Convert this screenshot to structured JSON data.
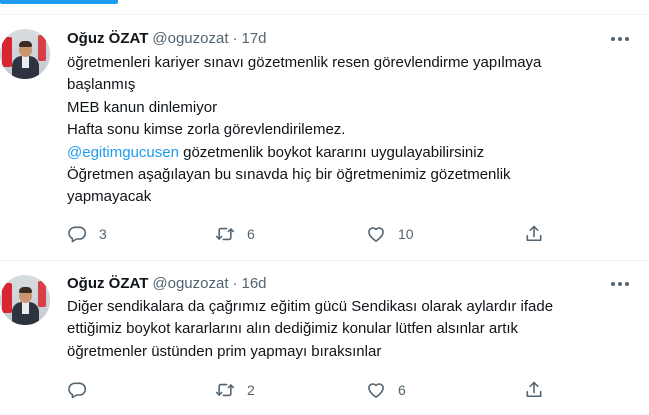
{
  "tweets": [
    {
      "display_name": "Oğuz ÖZAT",
      "handle": "@oguzozat",
      "separator": "·",
      "time": "17d",
      "lines": [
        "öğretmenleri kariyer sınavı gözetmenlik resen görevlendirme yapılmaya",
        "başlanmış",
        "MEB kanun dinlemiyor",
        "Hafta sonu kimse zorla görevlendirilemez."
      ],
      "mention": "@egitimgucusen",
      "mention_rest": " gözetmenlik boykot kararını uygulayabilirsiniz",
      "lines_after": [
        "Öğretmen aşağılayan bu sınavda hiç bir öğretmenimiz gözetmenlik",
        "yapmayacak"
      ],
      "reply_count": "3",
      "retweet_count": "6",
      "like_count": "10"
    },
    {
      "display_name": "Oğuz ÖZAT",
      "handle": "@oguzozat",
      "separator": "·",
      "time": "16d",
      "lines": [
        "Diğer sendikalara da çağrımız eğitim gücü Sendikası olarak aylardır ifade",
        "ettiğimiz boykot kararlarını alın dediğimiz konular lütfen alsınlar artık",
        "öğretmenler üstünden prim yapmayı bıraksınlar"
      ],
      "reply_count": "",
      "retweet_count": "2",
      "like_count": "6"
    }
  ],
  "icons": {
    "reply": "reply-icon",
    "retweet": "retweet-icon",
    "like": "heart-icon",
    "share": "share-icon",
    "more": "more-icon"
  },
  "colors": {
    "accent": "#1d9bf0",
    "text": "#0f1419",
    "secondary": "#536471",
    "divider": "#eff3f4"
  }
}
